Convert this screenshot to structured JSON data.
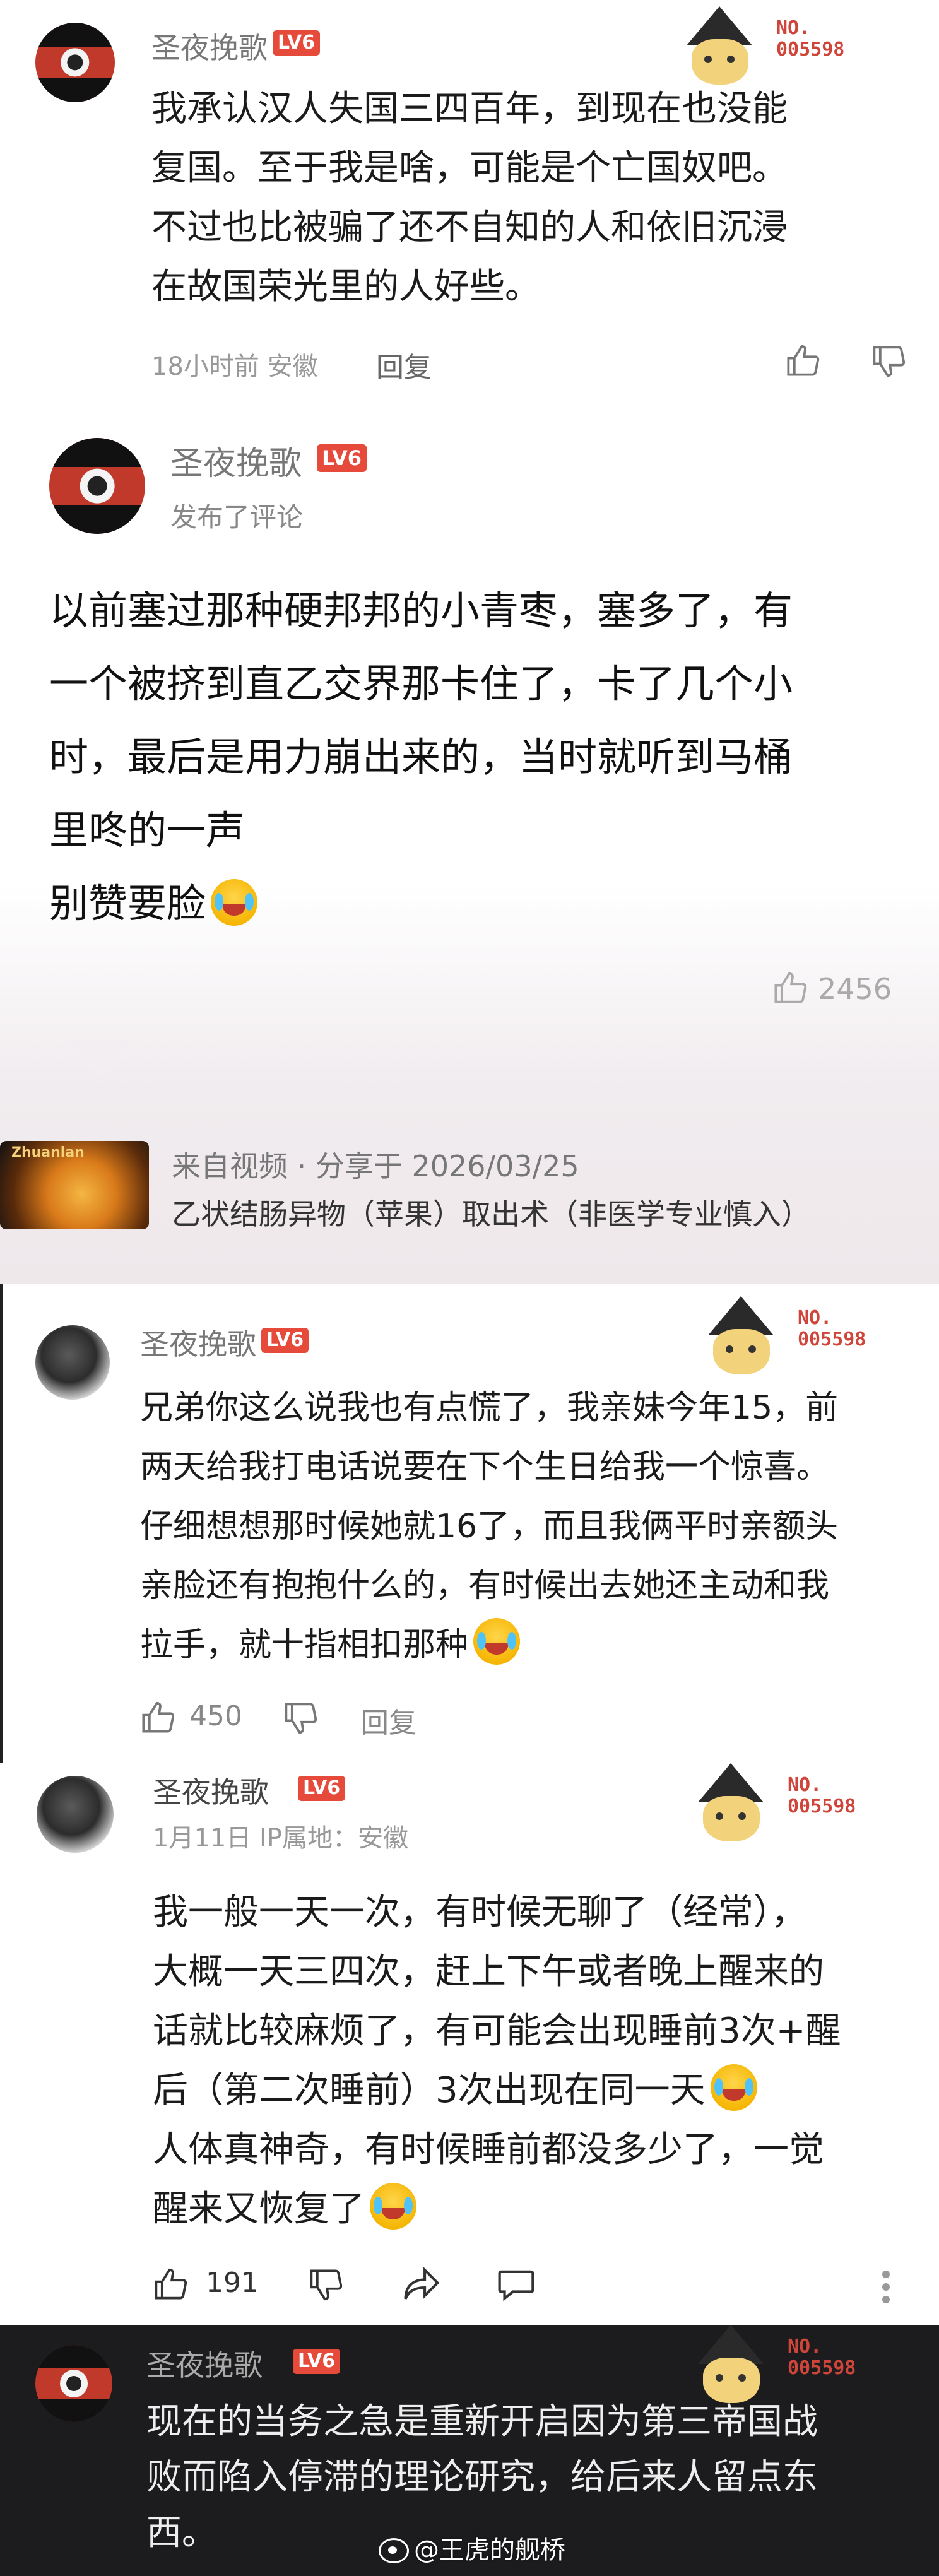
{
  "comment1": {
    "username": "圣夜挽歌",
    "level": "LV6",
    "badge_no": "NO.\n005598",
    "lines": [
      "我承认汉人失国三四百年，到现在也没能",
      "复国。至于我是啥，可能是个亡国奴吧。",
      "不过也比被骗了还不自知的人和依旧沉浸",
      "在故国荣光里的人好些。"
    ],
    "time_loc": "18小时前 安徽",
    "reply_label": "回复"
  },
  "comment2": {
    "username": "圣夜挽歌",
    "level": "LV6",
    "subtitle": "发布了评论",
    "lines": [
      "以前塞过那种硬邦邦的小青枣，塞多了，有",
      "一个被挤到直乙交界那卡住了，卡了几个小",
      "时，最后是用力崩出来的，当时就听到马桶",
      "里咚的一声",
      "别赞要脸"
    ],
    "like_count": "2456",
    "video_source": "来自视频 · 分享于 2026/03/25",
    "video_title": "乙状结肠异物（苹果）取出术（非医学专业慎入）",
    "video_tag": "Zhuanlan"
  },
  "comment3": {
    "username": "圣夜挽歌",
    "level": "LV6",
    "badge_no": "NO.\n005598",
    "lines": [
      "兄弟你这么说我也有点慌了，我亲妹今年15，前",
      "两天给我打电话说要在下个生日给我一个惊喜。",
      "仔细想想那时候她就16了，而且我俩平时亲额头",
      "亲脸还有抱抱什么的，有时候出去她还主动和我",
      "拉手，就十指相扣那种"
    ],
    "like_count": "450",
    "reply_label": "回复"
  },
  "comment4": {
    "username": "圣夜挽歌",
    "level": "LV6",
    "badge_no": "NO.\n005598",
    "date_ip": "1月11日 IP属地：安徽",
    "lines": [
      "我一般一天一次，有时候无聊了（经常），",
      "大概一天三四次，赶上下午或者晚上醒来的",
      "话就比较麻烦了，有可能会出现睡前3次+醒",
      "后（第二次睡前）3次出现在同一天",
      "人体真神奇，有时候睡前都没多少了，一觉",
      "醒来又恢复了"
    ],
    "like_count": "191"
  },
  "comment5": {
    "username": "圣夜挽歌",
    "level": "LV6",
    "badge_no": "NO.\n005598",
    "lines": [
      "现在的当务之急是重新开启因为第三帝国战",
      "败而陷入停滞的理论研究，给后来人留点东",
      "西。"
    ]
  },
  "watermark": "@王虎的舰桥",
  "colors": {
    "level_badge": "#e64a3b",
    "badge_no": "#d0453a",
    "dark_panel": "#1c1c1e"
  }
}
